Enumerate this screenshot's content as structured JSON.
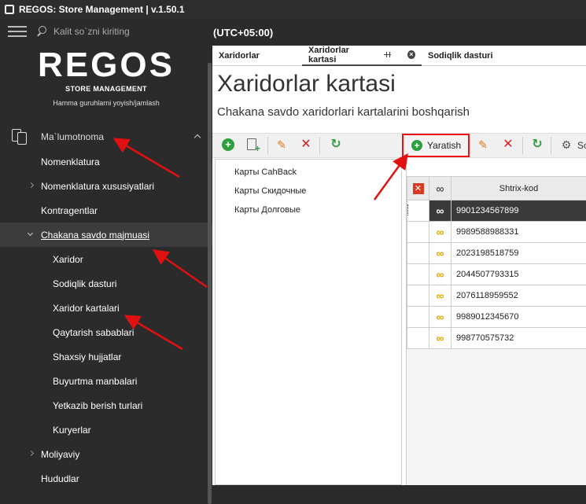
{
  "window": {
    "title": "REGOS: Store Management | v.1.50.1"
  },
  "search": {
    "placeholder": "Kalit so`zni kiriting"
  },
  "timezone": "(UTC+05:00)",
  "logo": {
    "brand": "REGOS",
    "subtitle": "STORE MANAGEMENT",
    "hint": "Hamma guruhlarni yoyish/jamlash"
  },
  "nav": {
    "section": "Ma`lumotnoma",
    "items": [
      {
        "label": "Nomenklatura"
      },
      {
        "label": "Nomenklatura xususiyatlari"
      },
      {
        "label": "Kontragentlar"
      },
      {
        "label": "Chakana savdo majmuasi"
      },
      {
        "label": "Xaridor"
      },
      {
        "label": "Sodiqlik dasturi"
      },
      {
        "label": "Xaridor kartalari"
      },
      {
        "label": "Qaytarish sabablari"
      },
      {
        "label": "Shaxsiy hujjatlar"
      },
      {
        "label": "Buyurtma manbalari"
      },
      {
        "label": "Yetkazib berish turlari"
      },
      {
        "label": "Kuryerlar"
      },
      {
        "label": "Moliyaviy"
      },
      {
        "label": "Hududlar"
      }
    ]
  },
  "tabs": [
    {
      "label": "Xaridorlar"
    },
    {
      "label": "Xaridorlar kartasi"
    },
    {
      "label": "Sodiqlik dasturi"
    }
  ],
  "page": {
    "title": "Xaridorlar kartasi",
    "subtitle": "Chakana savdo xaridorlari kartalarini boshqarish"
  },
  "toolbar": {
    "create_label": "Yaratish",
    "settings_label": "Sc"
  },
  "card_types": [
    "Карты CahBack",
    "Карты Скидочные",
    "Карты Долговые"
  ],
  "grid": {
    "column": "Shtrix-kod",
    "rows": [
      "9901234567899",
      "9989588988331",
      "2023198518759",
      "2044507793315",
      "2076118959552",
      "9989012345670",
      "998770575732"
    ]
  },
  "colors": {
    "accent_red": "#e11111",
    "green": "#2e9e3f",
    "infinity": "#e0a800"
  }
}
